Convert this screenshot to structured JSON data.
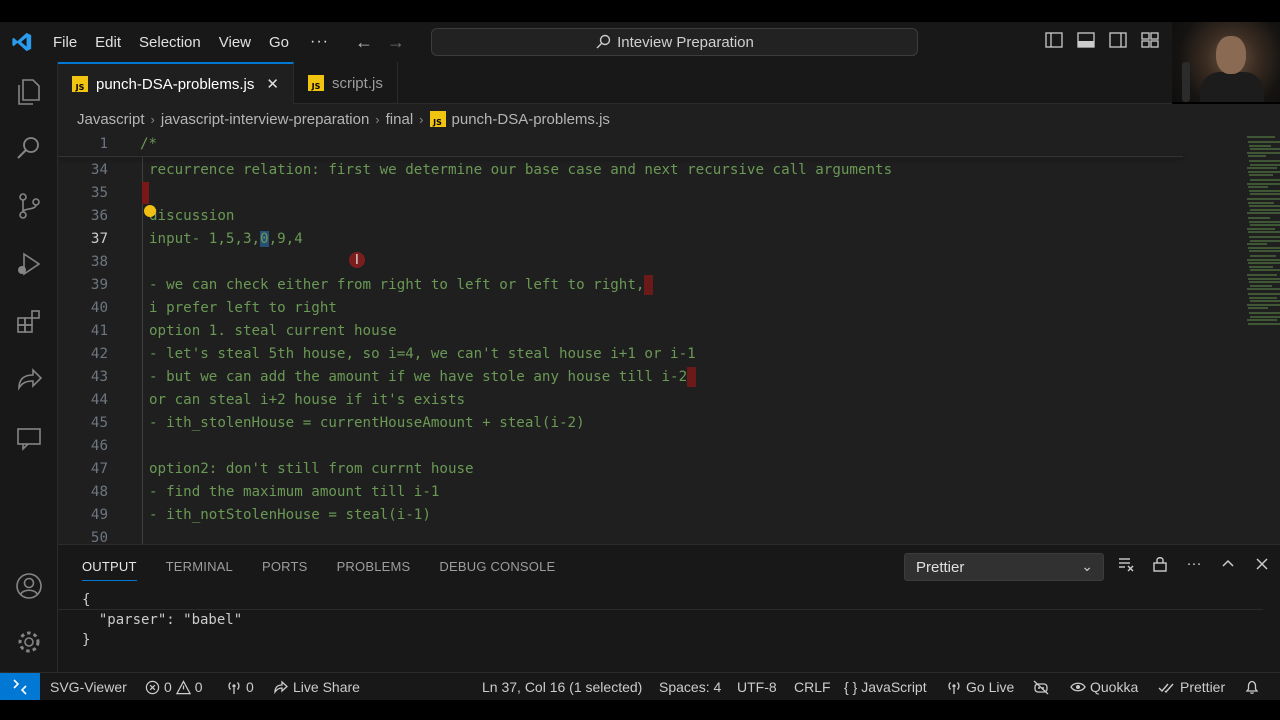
{
  "menu": [
    "File",
    "Edit",
    "Selection",
    "View",
    "Go"
  ],
  "menu_more": "···",
  "nav": {
    "back": "←",
    "forward": "→"
  },
  "command_center": {
    "text": "Inteview Preparation",
    "icon": "search-icon"
  },
  "tabs": [
    {
      "label": "punch-DSA-problems.js",
      "badge": "JS",
      "active": true,
      "close": "✕"
    },
    {
      "label": "script.js",
      "badge": "JS",
      "active": false
    }
  ],
  "breadcrumb": [
    "Javascript",
    "javascript-interview-preparation",
    "final",
    "punch-DSA-problems.js"
  ],
  "breadcrumb_sep": "›",
  "editor": {
    "sticky": {
      "number": "1",
      "text": "/*"
    },
    "lines": [
      {
        "n": "34",
        "text": "recurrence relation: first we determine our base case and next recursive call arguments"
      },
      {
        "n": "35",
        "text": ""
      },
      {
        "n": "36",
        "text": "discussion"
      },
      {
        "n": "37",
        "pre": "input- 1,5,3,",
        "sel": "0",
        "post": ",9,4"
      },
      {
        "n": "38",
        "text": ""
      },
      {
        "n": "39",
        "text": "- we can check either from right to left or left to right,"
      },
      {
        "n": "40",
        "text": "i prefer left to right"
      },
      {
        "n": "41",
        "text": "option 1. steal current house"
      },
      {
        "n": "42",
        "text": "- let's steal 5th house, so i=4, we can't steal house i+1 or i-1"
      },
      {
        "n": "43",
        "text": "- but we can add the amount if we have stole any house till i-2"
      },
      {
        "n": "44",
        "text": "or can steal i+2 house if it's exists"
      },
      {
        "n": "45",
        "text": "- ith_stolenHouse = currentHouseAmount + steal(i-2)"
      },
      {
        "n": "46",
        "text": ""
      },
      {
        "n": "47",
        "text": "option2: don't still from currnt house"
      },
      {
        "n": "48",
        "text": "- find the maximum amount till i-1"
      },
      {
        "n": "49",
        "text": "- ith_notStolenHouse = steal(i-1)"
      },
      {
        "n": "50",
        "text": ""
      }
    ],
    "colors": {
      "comment": "#6a9955",
      "selection": "#264f78",
      "line_number": "#6e7681"
    }
  },
  "panel": {
    "tabs": [
      "OUTPUT",
      "TERMINAL",
      "PORTS",
      "PROBLEMS",
      "DEBUG CONSOLE"
    ],
    "active_tab": "OUTPUT",
    "output_channel": "Prettier",
    "output_lines": [
      "{",
      "  \"parser\": \"babel\"",
      "}"
    ]
  },
  "status": {
    "remote_icon": "remote-icon",
    "svg_viewer": "SVG-Viewer",
    "errors": "0",
    "warnings": "0",
    "ports": "0",
    "live_share": "Live Share",
    "position": "Ln 37, Col 16 (1 selected)",
    "spaces": "Spaces: 4",
    "encoding": "UTF-8",
    "eol": "CRLF",
    "language": "JavaScript",
    "go_live": "Go Live",
    "quokka": "Quokka",
    "prettier": "Prettier",
    "language_braces": "{ }"
  },
  "accent": "#0078d4"
}
